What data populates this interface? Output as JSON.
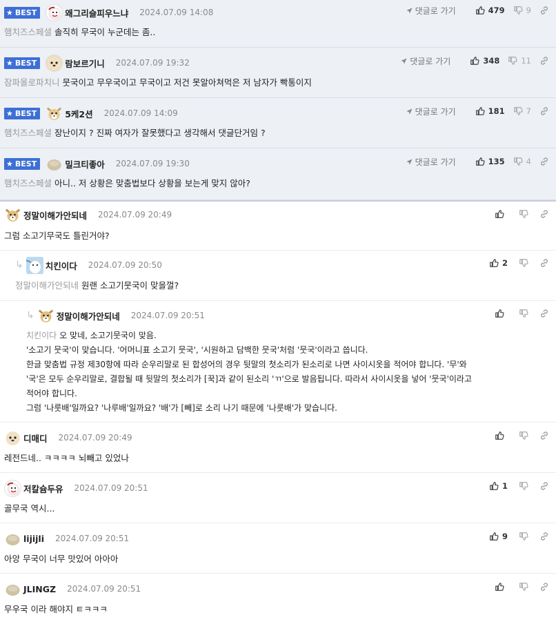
{
  "best_badge": "BEST",
  "reply_to_label": "댓글로 가기",
  "best": [
    {
      "nick": "왜그리슬피우느냐",
      "date": "2024.07.09 14:08",
      "mention": "햄치즈스페셜",
      "text": "솔직히 무국이 누군데는 좀..",
      "up": "479",
      "down": "9"
    },
    {
      "nick": "람보르기니",
      "date": "2024.07.09 19:32",
      "mention": "잠파올로파치니",
      "text": "뭇국이고 무우국이고 무국이고 저건 못알아쳐먹은 저 남자가 빡통이지",
      "up": "348",
      "down": "11"
    },
    {
      "nick": "5케2션",
      "date": "2024.07.09 14:09",
      "mention": "햄치즈스페셜",
      "text": "장난이지 ? 진짜 여자가 잘못했다고 생각해서 댓글단거임 ?",
      "up": "181",
      "down": "7"
    },
    {
      "nick": "밀크티좋아",
      "date": "2024.07.09 19:30",
      "mention": "햄치즈스페셜",
      "text": "아니.. 저 상황은 맞춤법보다 상황을 보는게 맞지 않아?",
      "up": "135",
      "down": "4"
    }
  ],
  "comments": [
    {
      "nick": "정말이해가안되네",
      "date": "2024.07.09 20:49",
      "text": "그럼 소고기무국도 틀린거야?",
      "up": ""
    },
    {
      "nick": "치킨이다",
      "date": "2024.07.09 20:50",
      "mention": "정말이해가안되네",
      "text": "원랜 소고기뭇국이 맞을껄?",
      "up": "2"
    },
    {
      "nick": "정말이해가안되네",
      "date": "2024.07.09 20:51",
      "mention": "치킨이다",
      "lines": [
        "오 맞네, 소고기뭇국이 맞음.",
        "'소고기 뭇국'이 맞습니다. '어머니표 소고기 뭇국', '시원하고 담백한 뭇국'처럼 '뭇국'이라고 씁니다.",
        "한글 맞춤법 규정 제30항에 따라 순우리말로 된 합성어의 경우 뒷말의 첫소리가 된소리로 나면 사이시옷을 적어야 합니다. '무'와",
        "'국'은 모두 순우리말로, 결합될 때 뒷말의 첫소리가 [꾹]과 같이 된소리 'ㄲ'으로 발음됩니다. 따라서 사이시옷을 넣어 '뭇국'이라고",
        "적어야 합니다.",
        "그럼 '나룻배'일까요? '나루배'일까요? '배'가 [빼]로 소리 나기 때문에 '나룻배'가 맞습니다."
      ],
      "up": ""
    },
    {
      "nick": "디매디",
      "date": "2024.07.09 20:49",
      "text": "레전드네.. ㅋㅋㅋㅋ 뇌빼고 있었나",
      "up": ""
    },
    {
      "nick": "저칼슘두유",
      "date": "2024.07.09 20:51",
      "text": "골무국 역시...",
      "up": "1"
    },
    {
      "nick": "lijijli",
      "date": "2024.07.09 20:51",
      "text": "아앙 무국이 너무 맛있어 아아아",
      "up": "9"
    },
    {
      "nick": "JLINGZ",
      "date": "2024.07.09 20:51",
      "text": "무우국 이라 해야지 ㅌㅋㅋㅋ",
      "up": ""
    }
  ]
}
